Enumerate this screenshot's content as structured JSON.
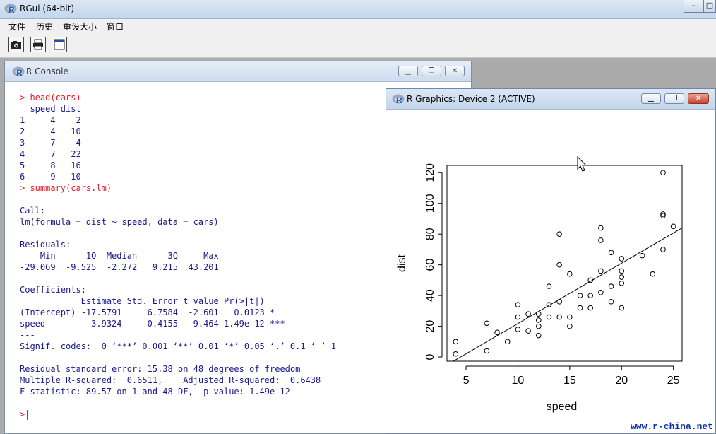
{
  "app": {
    "title": "RGui (64-bit)",
    "menu": [
      "文件",
      "历史",
      "重设大小",
      "窗口"
    ],
    "toolbar": [
      "camera-icon",
      "printer-icon",
      "window-icon"
    ]
  },
  "console": {
    "title": "R Console",
    "lines": [
      {
        "text": "> head(cars)",
        "color": "red"
      },
      {
        "text": "  speed dist",
        "color": "blue"
      },
      {
        "text": "1     4    2",
        "color": "blue"
      },
      {
        "text": "2     4   10",
        "color": "blue"
      },
      {
        "text": "3     7    4",
        "color": "blue"
      },
      {
        "text": "4     7   22",
        "color": "blue"
      },
      {
        "text": "5     8   16",
        "color": "blue"
      },
      {
        "text": "6     9   10",
        "color": "blue"
      },
      {
        "text": "> summary(cars.lm)",
        "color": "red"
      },
      {
        "text": "",
        "color": "blue"
      },
      {
        "text": "Call:",
        "color": "blue"
      },
      {
        "text": "lm(formula = dist ~ speed, data = cars)",
        "color": "blue"
      },
      {
        "text": "",
        "color": "blue"
      },
      {
        "text": "Residuals:",
        "color": "blue"
      },
      {
        "text": "    Min      1Q  Median      3Q     Max",
        "color": "blue"
      },
      {
        "text": "-29.069  -9.525  -2.272   9.215  43.201",
        "color": "blue"
      },
      {
        "text": "",
        "color": "blue"
      },
      {
        "text": "Coefficients:",
        "color": "blue"
      },
      {
        "text": "            Estimate Std. Error t value Pr(>|t|)",
        "color": "blue"
      },
      {
        "text": "(Intercept) -17.5791     6.7584  -2.601   0.0123 *",
        "color": "blue"
      },
      {
        "text": "speed         3.9324     0.4155   9.464 1.49e-12 ***",
        "color": "blue"
      },
      {
        "text": "---",
        "color": "blue"
      },
      {
        "text": "Signif. codes:  0 ‘***’ 0.001 ‘**’ 0.01 ‘*’ 0.05 ‘.’ 0.1 ‘ ’ 1",
        "color": "blue"
      },
      {
        "text": "",
        "color": "blue"
      },
      {
        "text": "Residual standard error: 15.38 on 48 degrees of freedom",
        "color": "blue"
      },
      {
        "text": "Multiple R-squared:  0.6511,    Adjusted R-squared:  0.6438",
        "color": "blue"
      },
      {
        "text": "F-statistic: 89.57 on 1 and 48 DF,  p-value: 1.49e-12",
        "color": "blue"
      }
    ],
    "prompt": ">",
    "colors": {
      "command": "#e0202a",
      "output": "#1a1a8c"
    }
  },
  "graphics": {
    "title": "R Graphics: Device 2 (ACTIVE)"
  },
  "chart_data": {
    "type": "scatter",
    "title": "",
    "xlabel": "speed",
    "ylabel": "dist",
    "xlim": [
      4,
      25
    ],
    "ylim": [
      2,
      120
    ],
    "xticks": [
      5,
      10,
      15,
      20,
      25
    ],
    "yticks": [
      0,
      20,
      40,
      60,
      80,
      100,
      120
    ],
    "grid": false,
    "series": [
      {
        "x": [
          4,
          4,
          7,
          7,
          8,
          9,
          10,
          10,
          10,
          11,
          11,
          12,
          12,
          12,
          12,
          13,
          13,
          13,
          13,
          14,
          14,
          14,
          14,
          15,
          15,
          15,
          16,
          16,
          17,
          17,
          17,
          18,
          18,
          18,
          18,
          19,
          19,
          19,
          20,
          20,
          20,
          20,
          20,
          22,
          23,
          24,
          24,
          24,
          24,
          25
        ],
        "y": [
          2,
          10,
          4,
          22,
          16,
          10,
          18,
          26,
          34,
          17,
          28,
          14,
          20,
          24,
          28,
          26,
          34,
          34,
          46,
          26,
          36,
          60,
          80,
          20,
          26,
          54,
          32,
          40,
          32,
          40,
          50,
          42,
          56,
          76,
          84,
          36,
          46,
          68,
          32,
          48,
          52,
          56,
          64,
          66,
          54,
          70,
          92,
          93,
          120,
          85
        ]
      }
    ],
    "regression_line": {
      "intercept": -17.5791,
      "slope": 3.9324
    }
  },
  "watermark": "www.r-china.net"
}
